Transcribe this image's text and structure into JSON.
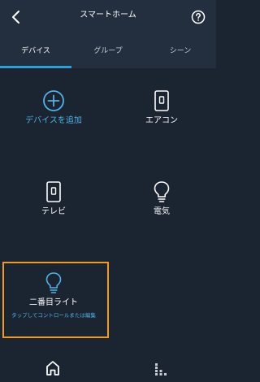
{
  "header": {
    "title": "スマートホーム"
  },
  "tabs": [
    {
      "label": "デバイス",
      "active": true
    },
    {
      "label": "グループ",
      "active": false
    },
    {
      "label": "シーン",
      "active": false
    }
  ],
  "tiles": [
    {
      "label": "デバイスを追加",
      "icon": "plus-circle-icon"
    },
    {
      "label": "エアコン",
      "icon": "switch-icon"
    },
    {
      "label": "テレビ",
      "icon": "switch-icon"
    },
    {
      "label": "電気",
      "icon": "bulb-icon"
    },
    {
      "label": "二番目ライト",
      "sub": "タップしてコントロールまたは編集",
      "icon": "bulb-icon",
      "highlighted": true
    }
  ],
  "bottom_nav": [
    {
      "icon": "home-icon"
    },
    {
      "icon": "equalizer-icon"
    }
  ],
  "colors": {
    "background": "#1b2431",
    "bar": "#232f3e",
    "accent": "#2ba0d8",
    "highlight": "#ef9b21"
  }
}
